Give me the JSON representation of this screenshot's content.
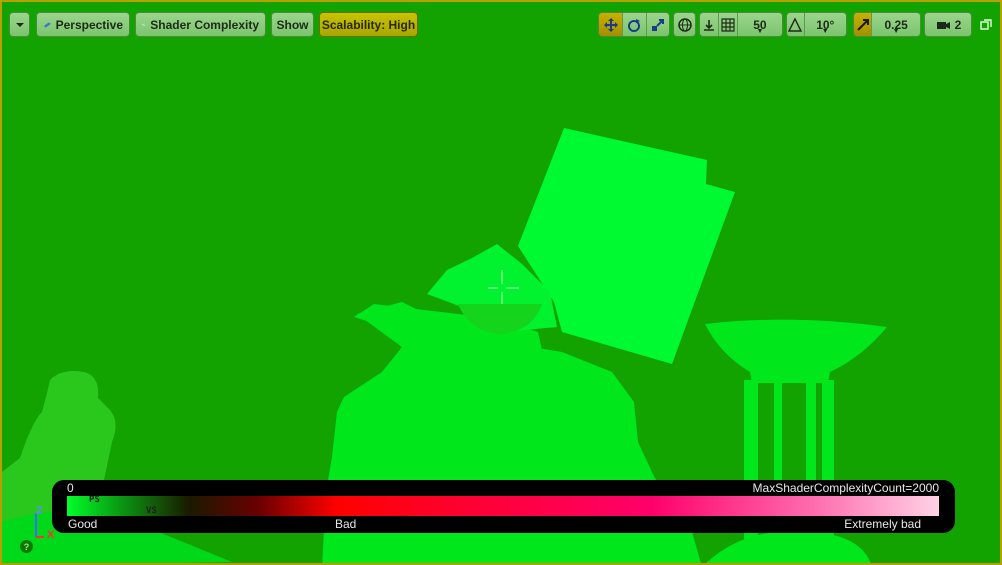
{
  "toolbar": {
    "perspective_label": "Perspective",
    "view_mode_label": "Shader Complexity",
    "show_label": "Show",
    "scalability_label": "Scalability: High",
    "grid_snap_value": "50",
    "rotation_snap_value": "10°",
    "scale_snap_value": "0.25",
    "camera_speed_value": "2"
  },
  "legend": {
    "min_label": "0",
    "max_label": "MaxShaderComplexityCount=2000",
    "ps_label": "PS",
    "vs_label": "VS",
    "good_label": "Good",
    "bad_label": "Bad",
    "extremely_bad_label": "Extremely bad"
  },
  "axis": {
    "z": "Z",
    "x": "X"
  },
  "colors": {
    "background": "#12a300",
    "mesh": "#00e81c",
    "mesh_bright": "#00ff33",
    "border": "#b8a000",
    "active_button": "#c7b100"
  }
}
